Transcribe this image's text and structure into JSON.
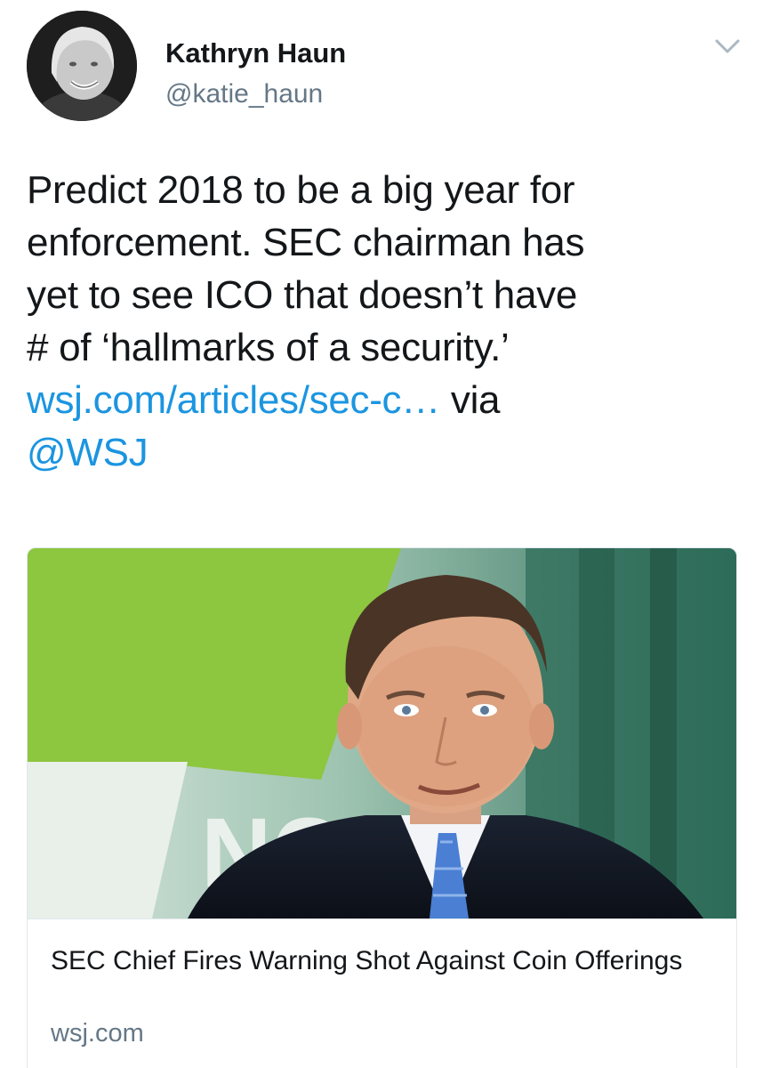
{
  "author": {
    "name": "Kathryn Haun",
    "handle": "@katie_haun",
    "avatar_icon": "profile-photo"
  },
  "menu": {
    "icon": "chevron-down-icon"
  },
  "tweet": {
    "line1": "Predict 2018 to be a big year for",
    "line2": "enforcement. SEC chairman has",
    "line3": "yet to see ICO that doesn’t have",
    "line4": "# of ‘hallmarks of a security.’",
    "link": "wsj.com/articles/sec-c…",
    "via": " via",
    "mention": "@WSJ"
  },
  "card": {
    "title": "SEC Chief Fires Warning Shot Against Coin Offerings",
    "domain": "wsj.com"
  },
  "colors": {
    "link": "#1b95e0",
    "text": "#14171a",
    "secondary": "#657786",
    "border": "#e1e8ed"
  }
}
